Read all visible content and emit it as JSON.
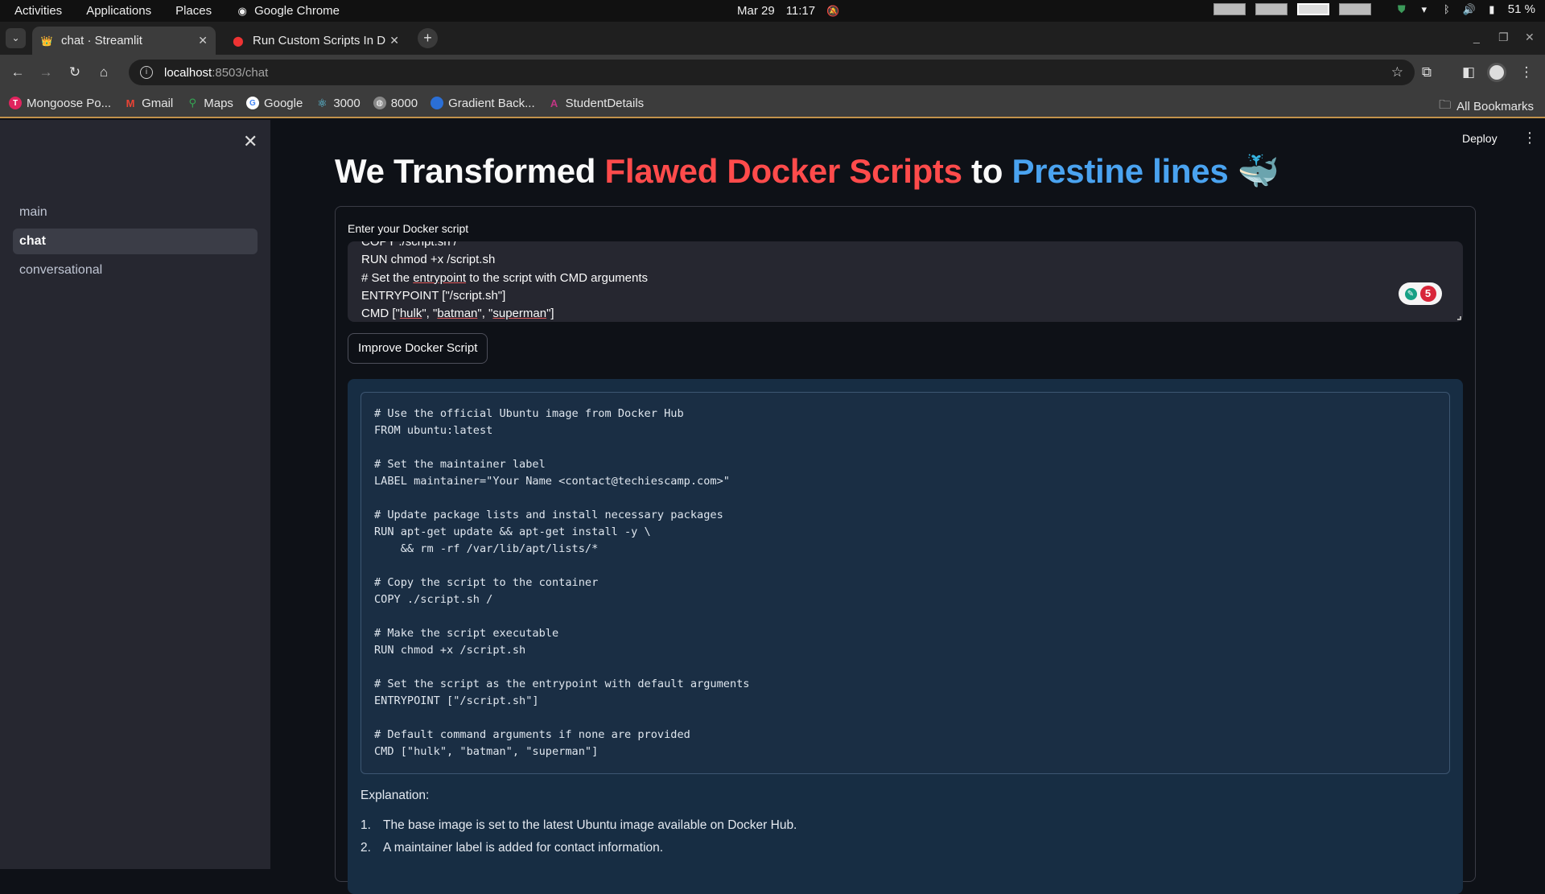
{
  "os_topbar": {
    "activities": "Activities",
    "applications": "Applications",
    "places": "Places",
    "active_app": "Google Chrome",
    "date": "Mar 29",
    "time": "11:17",
    "battery": "51 %"
  },
  "browser": {
    "tabs": [
      {
        "title": "chat · Streamlit",
        "active": true
      },
      {
        "title": "Run Custom Scripts In D",
        "active": false
      }
    ],
    "url_host": "localhost",
    "url_path": ":8503/chat",
    "bookmarks": [
      "Mongoose Po...",
      "Gmail",
      "Maps",
      "Google",
      "3000",
      "8000",
      "Gradient Back...",
      "StudentDetails"
    ],
    "all_bookmarks": "All Bookmarks"
  },
  "sidebar": {
    "items": [
      {
        "label": "main",
        "active": false
      },
      {
        "label": "chat",
        "active": true
      },
      {
        "label": "conversational",
        "active": false
      }
    ]
  },
  "header": {
    "deploy": "Deploy"
  },
  "title": {
    "part1": "We Transformed ",
    "part2": "Flawed Docker Scripts",
    "part3": " to ",
    "part4": "Prestine lines",
    "emoji": "🐳"
  },
  "form": {
    "label": "Enter your Docker script",
    "textarea_lines": {
      "l0": "COPY ./script.sh /",
      "l1": "RUN chmod +x /script.sh",
      "l2a": "# Set the ",
      "l2b": "entrypoint",
      "l2c": " to the script with CMD arguments",
      "l3": "ENTRYPOINT [\"/script.sh\"]",
      "l4a": "CMD [\"",
      "l4b": "hulk",
      "l4c": "\", \"",
      "l4d": "batman",
      "l4e": "\", \"",
      "l4f": "superman",
      "l4g": "\"]"
    },
    "grammar_count": "5",
    "button": "Improve Docker Script"
  },
  "result": {
    "code": "# Use the official Ubuntu image from Docker Hub\nFROM ubuntu:latest\n\n# Set the maintainer label\nLABEL maintainer=\"Your Name <contact@techiescamp.com>\"\n\n# Update package lists and install necessary packages\nRUN apt-get update && apt-get install -y \\\n    && rm -rf /var/lib/apt/lists/*\n\n# Copy the script to the container\nCOPY ./script.sh /\n\n# Make the script executable\nRUN chmod +x /script.sh\n\n# Set the script as the entrypoint with default arguments\nENTRYPOINT [\"/script.sh\"]\n\n# Default command arguments if none are provided\nCMD [\"hulk\", \"batman\", \"superman\"]",
    "explanation_title": "Explanation:",
    "explanation_items": [
      {
        "num": "1.",
        "text": "The base image is set to the latest Ubuntu image available on Docker Hub."
      },
      {
        "num": "2.",
        "text": "A maintainer label is added for contact information."
      }
    ]
  }
}
